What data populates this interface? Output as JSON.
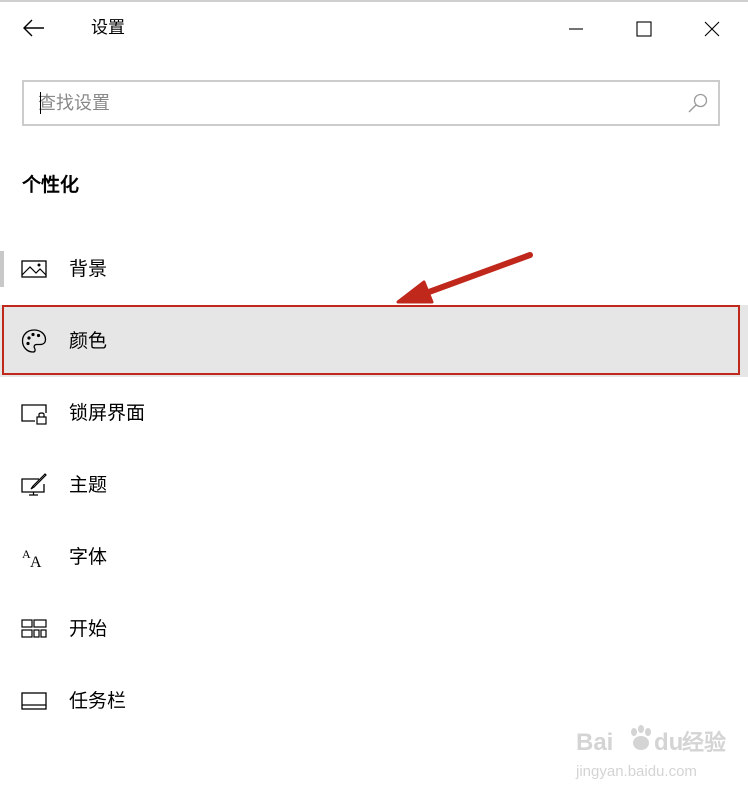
{
  "window": {
    "title": "设置",
    "back_icon": "arrow-left-icon",
    "controls": [
      "minimize-icon",
      "maximize-icon",
      "close-icon"
    ]
  },
  "search": {
    "placeholder": "查找设置",
    "value": "",
    "icon": "search-icon"
  },
  "section": {
    "title": "个性化"
  },
  "nav": {
    "items": [
      {
        "label": "背景",
        "icon": "picture-icon",
        "current": true
      },
      {
        "label": "颜色",
        "icon": "palette-icon",
        "selected": true
      },
      {
        "label": "锁屏界面",
        "icon": "lock-screen-icon"
      },
      {
        "label": "主题",
        "icon": "theme-brush-icon"
      },
      {
        "label": "字体",
        "icon": "font-icon"
      },
      {
        "label": "开始",
        "icon": "start-tiles-icon"
      },
      {
        "label": "任务栏",
        "icon": "taskbar-icon"
      }
    ]
  },
  "annotation": {
    "color": "#c0281c",
    "arrow": "red-arrow-pointing-to-颜色"
  },
  "watermark": {
    "brand": "Bai du",
    "cn": "经验",
    "url": "jingyan.baidu.com"
  }
}
